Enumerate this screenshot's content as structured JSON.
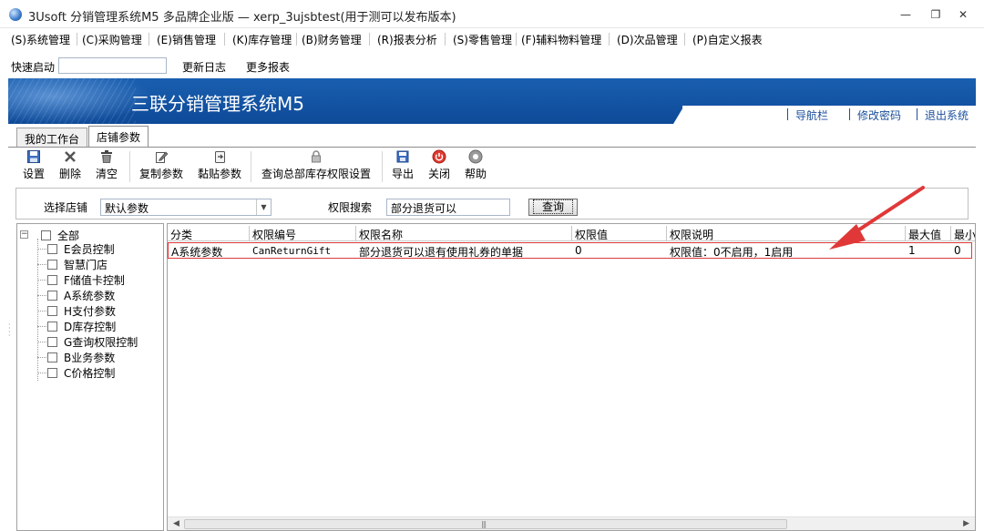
{
  "window": {
    "title": "3Usoft 分销管理系统M5 多品牌企业版 — xerp_3ujsbtest(用于测可以发布版本)",
    "minimize_glyph": "—",
    "restore_glyph": "❐",
    "close_glyph": "✕"
  },
  "menu": {
    "items": [
      {
        "label": "(S)系统管理"
      },
      {
        "label": "(C)采购管理"
      },
      {
        "label": "(E)销售管理"
      },
      {
        "label": "(K)库存管理"
      },
      {
        "label": "(B)财务管理"
      },
      {
        "label": "(R)报表分析"
      },
      {
        "label": "(S)零售管理"
      },
      {
        "label": "(F)辅料物料管理"
      },
      {
        "label": "(D)次品管理"
      },
      {
        "label": "(P)自定义报表"
      }
    ]
  },
  "quickbar": {
    "label": "快速启动",
    "input_value": "",
    "links": [
      "更新日志",
      "更多报表"
    ]
  },
  "banner": {
    "title": "三联分销管理系统M5",
    "nav": [
      "导航栏",
      "修改密码",
      "退出系统"
    ]
  },
  "tabs": [
    {
      "label": "我的工作台",
      "active": false
    },
    {
      "label": "店铺参数",
      "active": true
    }
  ],
  "toolbar": {
    "buttons": [
      {
        "label": "设置",
        "icon": "save-icon"
      },
      {
        "label": "删除",
        "icon": "delete-icon"
      },
      {
        "label": "清空",
        "icon": "trash-icon"
      },
      {
        "label": "复制参数",
        "icon": "edit-copy-icon"
      },
      {
        "label": "黏贴参数",
        "icon": "paste-icon"
      },
      {
        "label": "查询总部库存权限设置",
        "icon": "lock-icon"
      },
      {
        "label": "导出",
        "icon": "export-icon"
      },
      {
        "label": "关闭",
        "icon": "power-icon"
      },
      {
        "label": "帮助",
        "icon": "help-icon"
      }
    ]
  },
  "search": {
    "store_label": "选择店铺",
    "store_value": "默认参数",
    "perm_label": "权限搜索",
    "perm_value": "部分退货可以",
    "query_button": "查询"
  },
  "tree": {
    "root": "全部",
    "items": [
      "E会员控制",
      "智慧门店",
      "F储值卡控制",
      "A系统参数",
      "H支付参数",
      "D库存控制",
      "G查询权限控制",
      "B业务参数",
      "C价格控制"
    ]
  },
  "grid": {
    "columns": [
      "分类",
      "权限编号",
      "权限名称",
      "权限值",
      "权限说明",
      "最大值",
      "最小"
    ],
    "rows": [
      {
        "category": "A系统参数",
        "code": "CanReturnGift",
        "name": "部分退货可以退有使用礼券的单据",
        "value": "0",
        "description": "权限值：0不启用，1启用",
        "max": "1",
        "min": "0"
      }
    ],
    "annotation_color": "#e03838"
  }
}
